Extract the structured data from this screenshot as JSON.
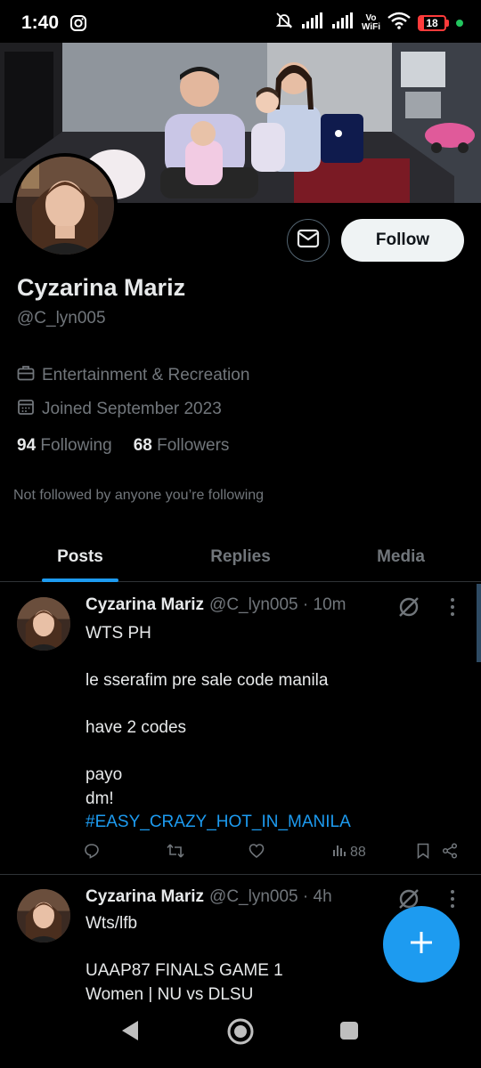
{
  "status_bar": {
    "time": "1:40",
    "left_icon": "instagram-icon",
    "right_icons": [
      "mute-icon",
      "signal-icon",
      "signal-icon",
      "vowifi-icon",
      "wifi-icon",
      "battery-icon",
      "green-dot"
    ],
    "vowifi_top": "Vo",
    "vowifi_bottom": "WiFi",
    "battery": "18",
    "battery_level": 0.18,
    "colors": {
      "battery": "#ff3b3b",
      "dot": "#22c55e"
    }
  },
  "profile": {
    "display_name": "Cyzarina Mariz",
    "handle": "@C_lyn005",
    "category": "Entertainment & Recreation",
    "joined": "Joined September 2023",
    "following_count": "94",
    "following_label": "Following",
    "followers_count": "68",
    "followers_label": "Followers",
    "not_followed_text": "Not followed by anyone you’re following",
    "follow_button": "Follow",
    "icons": [
      "mail-icon",
      "briefcase-icon",
      "calendar-icon"
    ]
  },
  "tabs": [
    {
      "label": "Posts",
      "active": true
    },
    {
      "label": "Replies",
      "active": false
    },
    {
      "label": "Media",
      "active": false
    }
  ],
  "posts": [
    {
      "name": "Cyzarina Mariz",
      "handle_time": "@C_lyn005 · 10m",
      "lines": [
        "WTS PH",
        "",
        "le sserafim pre sale code manila",
        "",
        "have 2 codes",
        "",
        "payo",
        "dm!"
      ],
      "hashtag": "#EASY_CRAZY_HOT_IN_MANILA",
      "views": "88",
      "action_icons": [
        "reply-icon",
        "repost-icon",
        "like-icon",
        "views-icon",
        "bookmark-icon",
        "share-icon"
      ]
    },
    {
      "name": "Cyzarina Mariz",
      "handle_time": "@C_lyn005 · 4h",
      "lines": [
        "Wts/lfb",
        "",
        "UAAP87 FINALS GAME 1",
        "Women | NU vs DLSU"
      ]
    }
  ],
  "colors": {
    "background": "#000000",
    "accent": "#1d9bf0",
    "text_primary": "#e7e9ea",
    "text_secondary": "#71767b",
    "divider": "#2f3336"
  },
  "nav": {
    "buttons": [
      "back-icon",
      "home-icon",
      "recents-icon"
    ]
  },
  "fab": {
    "icon": "plus-icon"
  }
}
